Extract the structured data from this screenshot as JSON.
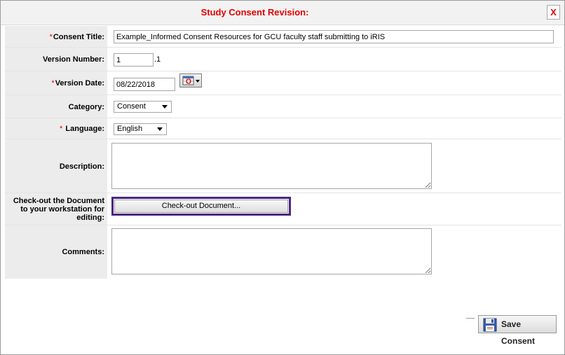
{
  "dialog": {
    "title": "Study Consent Revision:",
    "close_label": "X",
    "accent_color": "#e00000",
    "highlight_color": "#4b2683"
  },
  "form": {
    "consent_title": {
      "required_mark": "*",
      "label": "Consent Title:",
      "value": "Example_Informed Consent Resources for GCU faculty staff submitting to iRIS"
    },
    "version_number": {
      "label": "Version Number:",
      "value": "1",
      "suffix": ".1"
    },
    "version_date": {
      "required_mark": "*",
      "label": "Version Date:",
      "value": "08/22/2018",
      "calendar_icon": "calendar-icon"
    },
    "category": {
      "label": "Category:",
      "selected": "Consent"
    },
    "language": {
      "required_mark": "*",
      "label": " Language:",
      "selected": "English"
    },
    "description": {
      "label": "Description:",
      "value": ""
    },
    "checkout": {
      "label": "Check-out the Document to your workstation for editing:",
      "button_label": "Check-out Document..."
    },
    "comments": {
      "label": "Comments:",
      "value": ""
    }
  },
  "footer": {
    "save_label": "Save Consent",
    "save_icon": "floppy-disk-icon"
  }
}
